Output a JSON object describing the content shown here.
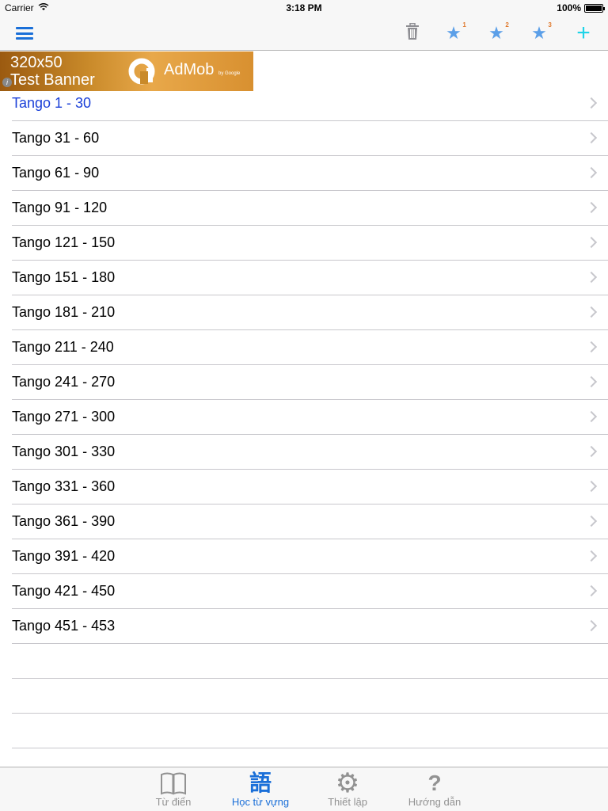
{
  "status_bar": {
    "carrier": "Carrier",
    "time": "3:18 PM",
    "battery": "100%"
  },
  "nav_bar": {
    "icons": [
      "menu-icon",
      "trash-icon",
      "star-icon",
      "star-icon",
      "star-icon",
      "plus-icon"
    ],
    "star_badges": [
      "1",
      "2",
      "3"
    ],
    "add_symbol": "+"
  },
  "ad": {
    "size_text": "320x50",
    "test_text": "Test Banner",
    "brand": "AdMob",
    "by_google": "by Google",
    "info_symbol": "i"
  },
  "list": {
    "items": [
      {
        "label": "Tango 1 - 30"
      },
      {
        "label": "Tango 31 - 60"
      },
      {
        "label": "Tango 61 - 90"
      },
      {
        "label": "Tango 91 - 120"
      },
      {
        "label": "Tango 121 - 150"
      },
      {
        "label": "Tango 151 - 180"
      },
      {
        "label": "Tango 181 - 210"
      },
      {
        "label": "Tango 211 - 240"
      },
      {
        "label": "Tango 241 - 270"
      },
      {
        "label": "Tango 271 - 300"
      },
      {
        "label": "Tango 301 - 330"
      },
      {
        "label": "Tango 331 - 360"
      },
      {
        "label": "Tango 361 - 390"
      },
      {
        "label": "Tango 391 - 420"
      },
      {
        "label": "Tango 421 - 450"
      },
      {
        "label": "Tango 451 - 453"
      }
    ],
    "selected_index": 0
  },
  "tab_bar": {
    "tabs": [
      {
        "label": "Từ điển",
        "icon": "book-icon"
      },
      {
        "label": "Học từ vựng",
        "icon": "kanji-icon",
        "glyph": "語"
      },
      {
        "label": "Thiết lập",
        "icon": "gear-icon",
        "glyph": "⚙"
      },
      {
        "label": "Hướng dẫn",
        "icon": "help-icon",
        "glyph": "?"
      }
    ],
    "active_index": 1
  },
  "colors": {
    "accent": "#1a6fd8",
    "selected_text": "#1a3fd8",
    "add_button": "#1ed4e8",
    "inactive_tab": "#929292"
  }
}
